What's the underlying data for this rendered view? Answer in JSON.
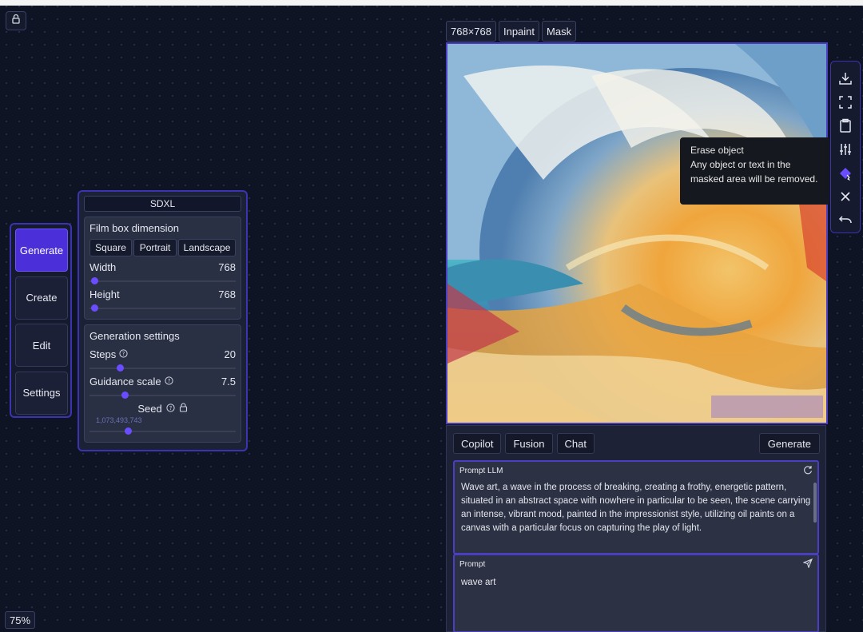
{
  "zoom": "75%",
  "nav": {
    "items": [
      {
        "label": "Generate",
        "active": true
      },
      {
        "label": "Create",
        "active": false
      },
      {
        "label": "Edit",
        "active": false
      },
      {
        "label": "Settings",
        "active": false
      }
    ]
  },
  "settings": {
    "model": "SDXL",
    "film_box": {
      "title": "Film box dimension",
      "options": [
        "Square",
        "Portrait",
        "Landscape"
      ],
      "width_label": "Width",
      "width_value": "768",
      "height_label": "Height",
      "height_value": "768"
    },
    "generation": {
      "title": "Generation settings",
      "steps_label": "Steps",
      "steps_value": "20",
      "guidance_label": "Guidance scale",
      "guidance_value": "7.5",
      "seed_label": "Seed",
      "seed_value": "1,073,493,743"
    }
  },
  "canvas": {
    "size_label": "768×768",
    "mode_inpaint": "Inpaint",
    "mode_mask": "Mask"
  },
  "tooltip": {
    "title": "Erase object",
    "body": "Any object or text in the masked area will be removed."
  },
  "bottom": {
    "tabs": [
      "Copilot",
      "Fusion",
      "Chat"
    ],
    "generate_label": "Generate",
    "llm_title": "Prompt LLM",
    "llm_text": "Wave art, a wave in the process of breaking, creating a frothy, energetic pattern, situated in an abstract space with nowhere in particular to be seen, the scene carrying an intense, vibrant mood, painted in the impressionist style, utilizing oil paints on a canvas with a particular focus on capturing the play of light.",
    "prompt_title": "Prompt",
    "prompt_text": "wave art"
  },
  "colors": {
    "accent": "#4b2fd8",
    "panel_border": "#3b33b0",
    "background": "#0f1424"
  }
}
